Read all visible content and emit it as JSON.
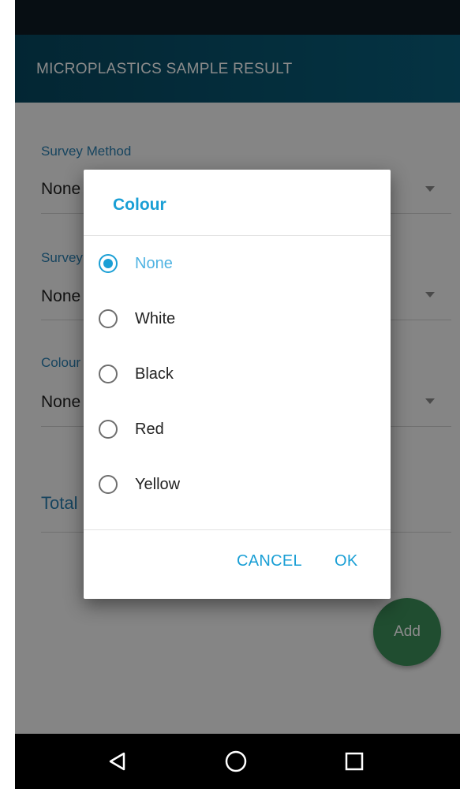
{
  "app_bar": {
    "title": "MICROPLASTICS SAMPLE RESULT"
  },
  "form": {
    "fields": [
      {
        "label": "Survey Method",
        "value": "None"
      },
      {
        "label": "Survey",
        "value": "None"
      },
      {
        "label": "Colour",
        "value": "None"
      }
    ],
    "total_label": "Total"
  },
  "fab": {
    "label": "Add",
    "color": "#3c8f5a"
  },
  "dialog": {
    "title": "Colour",
    "options": [
      {
        "label": "None",
        "selected": true
      },
      {
        "label": "White",
        "selected": false
      },
      {
        "label": "Black",
        "selected": false
      },
      {
        "label": "Red",
        "selected": false
      },
      {
        "label": "Yellow",
        "selected": false
      }
    ],
    "cancel_label": "CANCEL",
    "ok_label": "OK",
    "accent_color": "#1a9fd5"
  },
  "nav_bar": {
    "icons": [
      "back-icon",
      "home-icon",
      "recents-icon"
    ]
  }
}
